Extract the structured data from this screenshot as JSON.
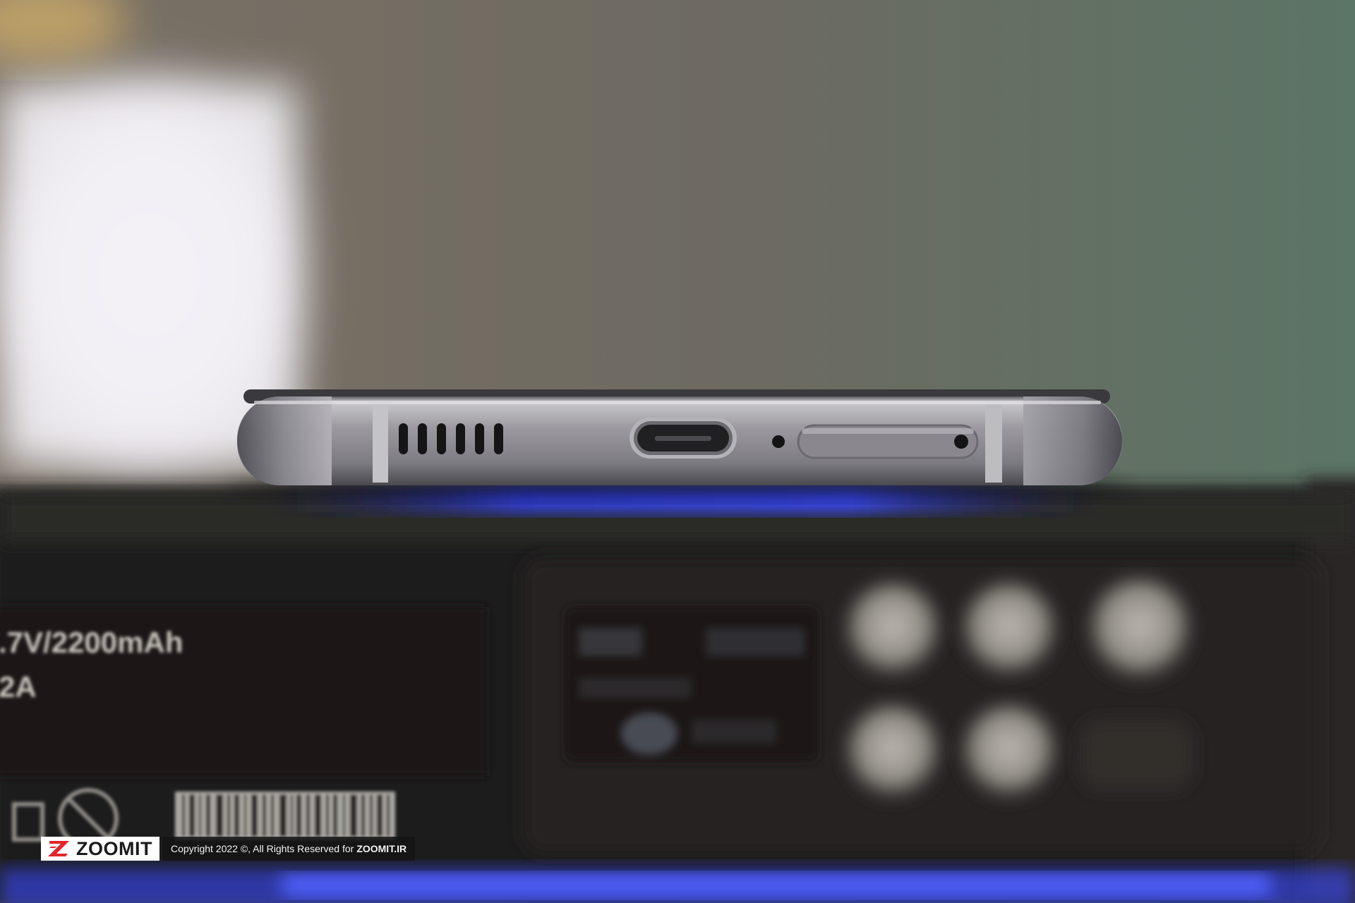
{
  "watermark": {
    "logo_text": "ZOOMIT",
    "copyright_text": "Copyright 2022 ©, All Rights Reserved for",
    "copyright_brand": "ZOOMIT.IR"
  },
  "background_box": {
    "spec_line_1": ".7V/2200mAh",
    "spec_line_2": "2A"
  },
  "icons": [
    "zoomit-logo-icon",
    "usb-c-port-icon",
    "speaker-grille-icon",
    "sim-tray-icon",
    "microphone-hole-icon"
  ],
  "colors": {
    "wall": "#6f6a62",
    "wall_green": "#5f7a6a",
    "phone_frame": "#8f8d93",
    "accent_blue": "#3a4cff",
    "box_dark": "#1e1c1b",
    "logo_red": "#e4242b"
  }
}
